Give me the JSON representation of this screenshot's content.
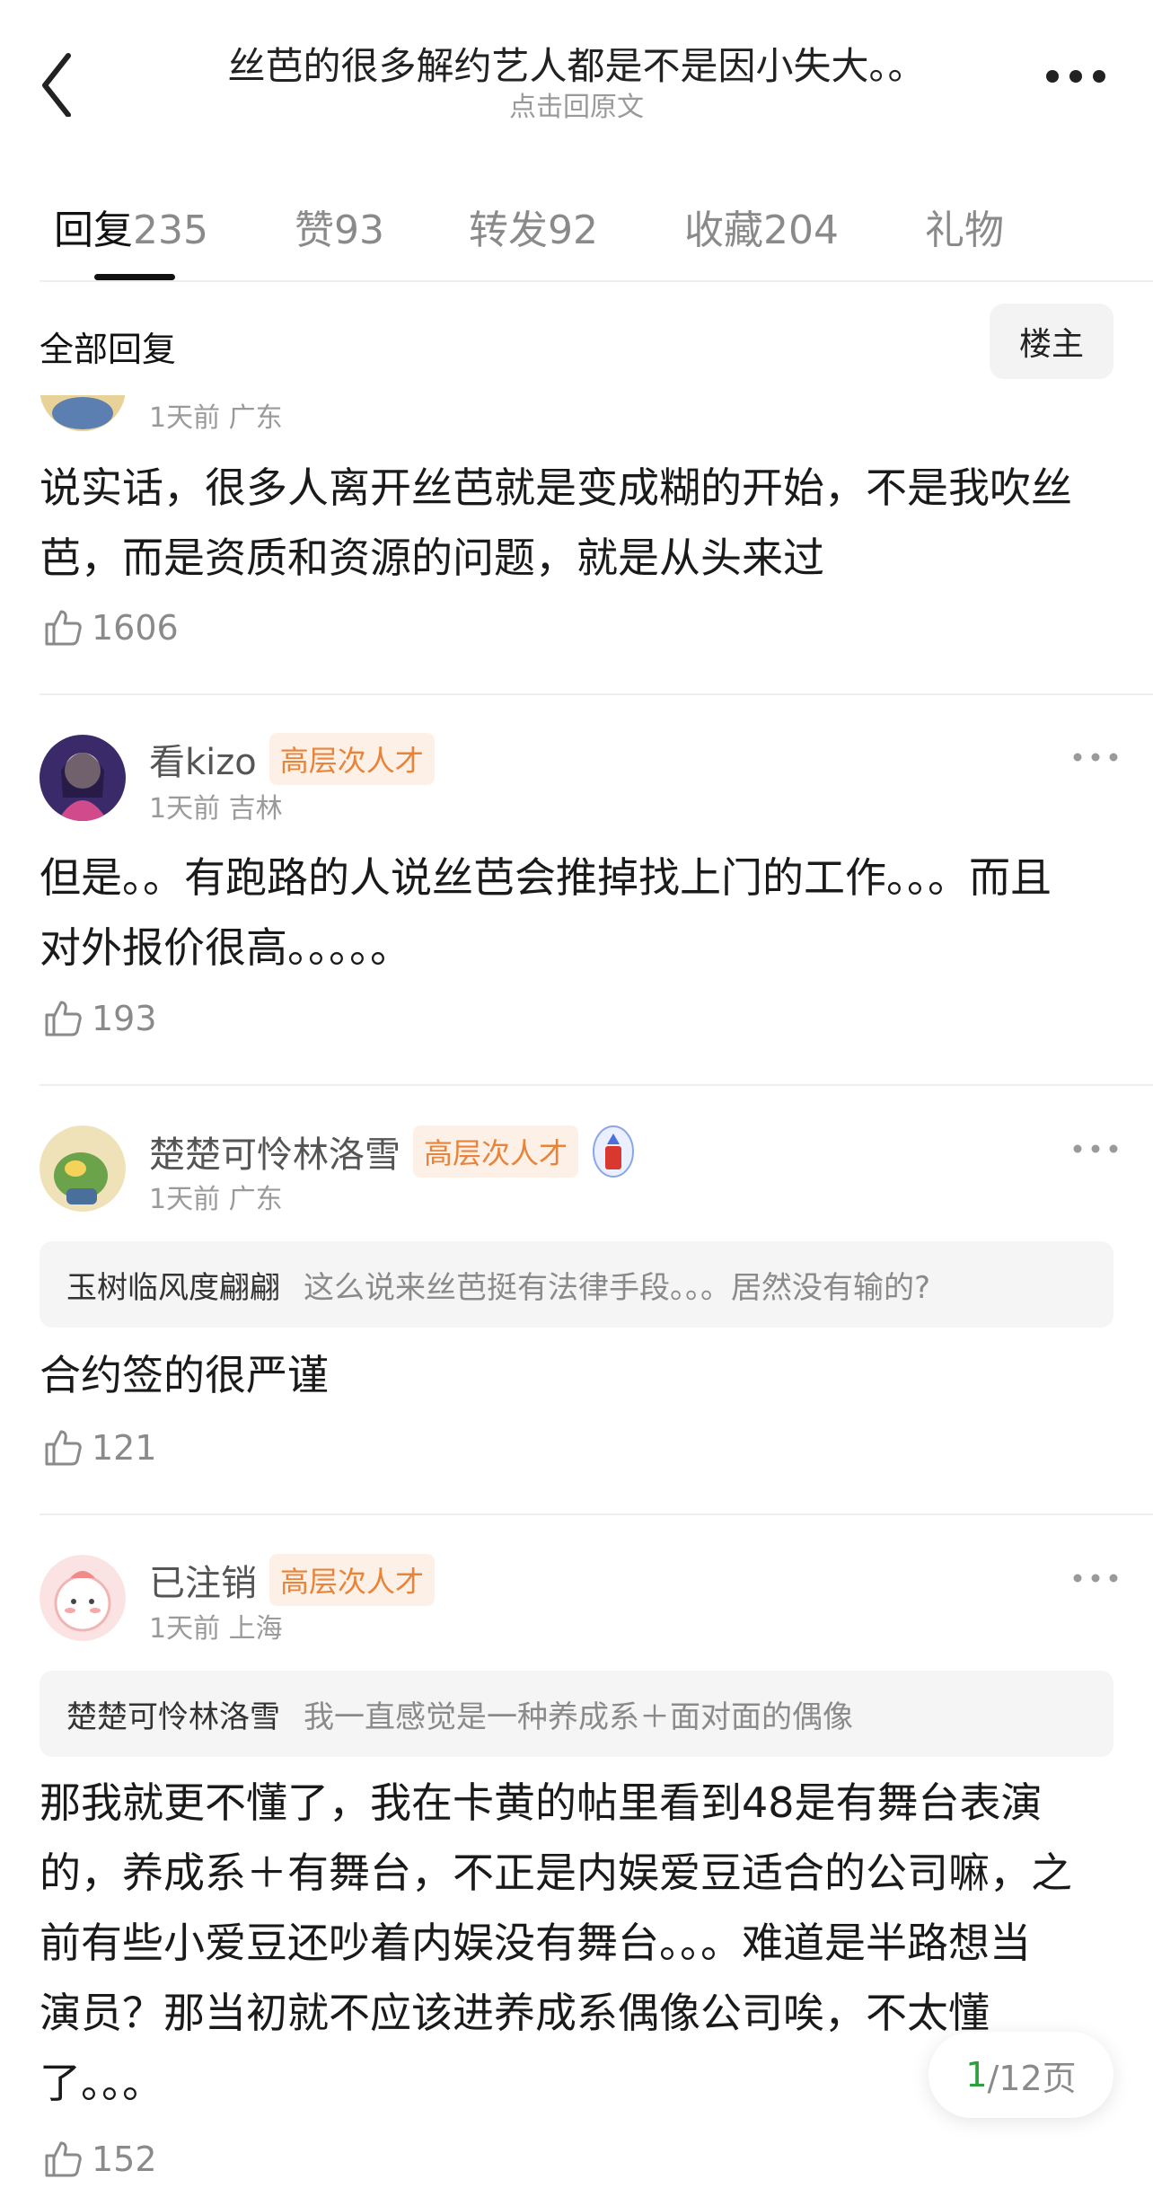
{
  "header": {
    "title": "丝芭的很多解约艺人都是不是因小失大。。",
    "subtitle": "点击回原文"
  },
  "tabs": [
    {
      "label": "回复",
      "count": "235"
    },
    {
      "label": "赞",
      "count": "93"
    },
    {
      "label": "转发",
      "count": "92"
    },
    {
      "label": "收藏",
      "count": "204"
    },
    {
      "label": "礼物",
      "count": ""
    }
  ],
  "filter": {
    "all_label": "全部回复",
    "op_label": "楼主"
  },
  "comments": [
    {
      "meta": "1天前 广东",
      "text_lines": [
        "说实话，很多人离开丝芭就是变成糊的开始，不是我吹丝",
        "芭，而是资质和资源的问题，就是从头来过"
      ],
      "likes": "1606"
    },
    {
      "username": "看kizo",
      "badge": "高层次人才",
      "meta": "1天前 吉林",
      "text_lines": [
        "但是。。有跑路的人说丝芭会推掉找上门的工作。。。而且",
        "对外报价很高。。。。。"
      ],
      "likes": "193"
    },
    {
      "username": "楚楚可怜林洛雪",
      "badge": "高层次人才",
      "meta": "1天前 广东",
      "quote": {
        "name": "玉树临风度翩翩",
        "text": "这么说来丝芭挺有法律手段。。。居然没有输的?"
      },
      "text_lines": [
        "合约签的很严谨"
      ],
      "likes": "121"
    },
    {
      "username": "已注销",
      "badge": "高层次人才",
      "meta": "1天前 上海",
      "quote": {
        "name": "楚楚可怜林洛雪",
        "text": "我一直感觉是一种养成系＋面对面的偶像"
      },
      "text_lines": [
        "那我就更不懂了，我在卡黄的帖里看到48是有舞台表演",
        "的，养成系＋有舞台，不正是内娱爱豆适合的公司嘛，之",
        "前有些小爱豆还吵着内娱没有舞台。。。难道是半路想当",
        "演员？那当初就不应该进养成系偶像公司唉，不太懂",
        "了。。。"
      ],
      "likes": "152"
    }
  ],
  "pager": {
    "current": "1",
    "total": "/12页"
  },
  "colors": {
    "badge_text": "#e8833a",
    "badge_bg": "#fdf1e7",
    "pager_current": "#2e9e3f"
  },
  "icons": [
    "back-chevron-icon",
    "more-dots-icon",
    "thumb-up-icon",
    "vip-shield-icon"
  ]
}
